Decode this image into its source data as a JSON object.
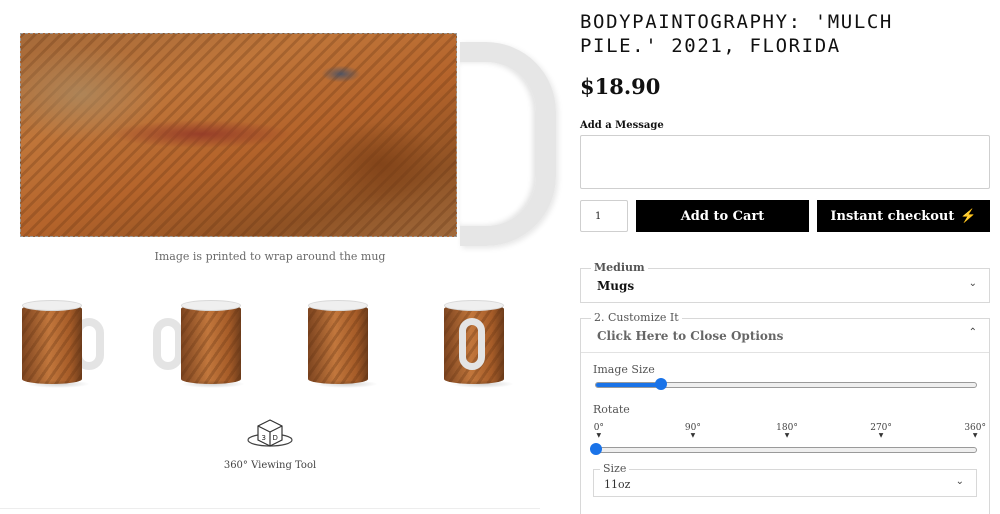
{
  "product": {
    "title": "BODYPAINTOGRAPHY: 'MULCH PILE.' 2021, FLORIDA",
    "price": "$18.90"
  },
  "preview": {
    "wrap_caption": "Image is printed to wrap around the mug",
    "thumbnails": [
      "mug-view-right",
      "mug-view-left",
      "mug-view-front",
      "mug-view-back"
    ],
    "viewer_label": "360° Viewing Tool",
    "viewer_icon": "3d-cube-icon"
  },
  "order": {
    "message_label": "Add a Message",
    "message_value": "",
    "quantity": "1",
    "add_to_cart_label": "Add to Cart",
    "instant_checkout_label": "Instant checkout",
    "instant_checkout_icon": "lightning-bolt-icon"
  },
  "options": {
    "medium_legend": "Medium",
    "medium_value": "Mugs",
    "customize_legend": "2. Customize It",
    "customize_toggle_label": "Click Here to Close Options",
    "image_size_label": "Image Size",
    "image_size_fraction": 0.17,
    "rotate_label": "Rotate",
    "rotate_ticks": [
      "0°",
      "90°",
      "180°",
      "270°",
      "360°"
    ],
    "rotate_value_fraction": 0.0,
    "size_legend": "Size",
    "size_value": "11oz"
  },
  "colors": {
    "button_bg": "#000000",
    "slider_accent": "#1a73e8"
  }
}
